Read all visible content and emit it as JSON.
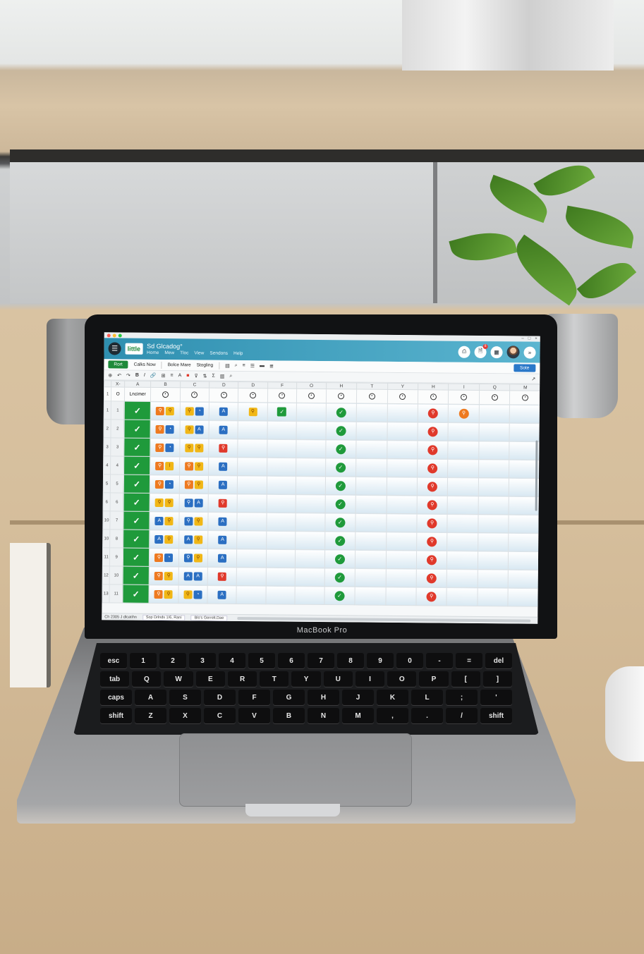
{
  "app": {
    "logo": "little",
    "title": "Sd Glcadog°",
    "menus": [
      "Home",
      "Mew",
      "Tloc",
      "View",
      "Sendons",
      "Help"
    ],
    "notification_count": "8",
    "window_controls": [
      "–",
      "□",
      "×"
    ],
    "colors": {
      "accent": "#2f8fb0",
      "primary_green": "#1e8a3a",
      "share_blue": "#2a78c9",
      "check_red": "#e0392b"
    }
  },
  "ribbon": {
    "primary": "Rort",
    "items": [
      "Calks Now",
      "Bolce Mare",
      "Stogling"
    ],
    "share": "Sote"
  },
  "grid": {
    "columns": [
      "X-",
      "A",
      "B",
      "C",
      "D",
      "D",
      "F",
      "O",
      "H",
      "T",
      "Y",
      "H",
      "I",
      "Q",
      "M"
    ],
    "header_label": "Lncimer",
    "header_row_number": "O",
    "rows": [
      {
        "outer": "1",
        "inner": "1"
      },
      {
        "outer": "2",
        "inner": "2"
      },
      {
        "outer": "3",
        "inner": "3"
      },
      {
        "outer": "4",
        "inner": "4"
      },
      {
        "outer": "5",
        "inner": "5"
      },
      {
        "outer": "6",
        "inner": "6"
      },
      {
        "outer": "10",
        "inner": "7"
      },
      {
        "outer": "10",
        "inner": "8"
      },
      {
        "outer": "11",
        "inner": "9"
      },
      {
        "outer": "12",
        "inner": "10"
      },
      {
        "outer": "13",
        "inner": "11"
      }
    ]
  },
  "status": {
    "left": "Ch 2305 J dlcatihn",
    "tabs": [
      "Sop Drlnds 1/6, Rani",
      "Blo's Gerrelt.Dae"
    ]
  },
  "laptop": {
    "brand": "MacBook Pro"
  }
}
